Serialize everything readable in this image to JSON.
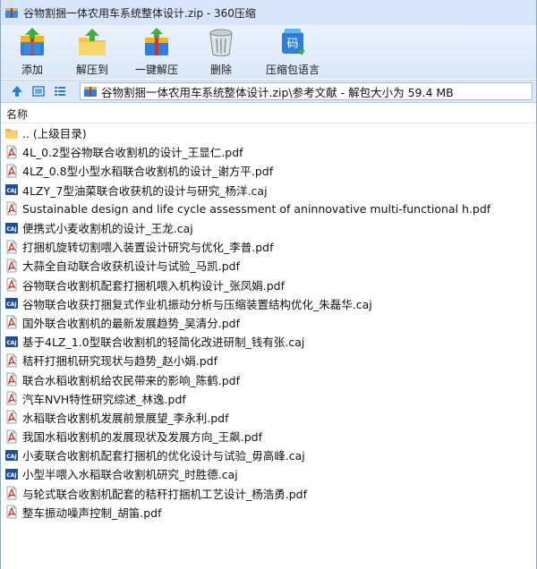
{
  "window": {
    "title": "谷物割捆一体农用车系统整体设计.zip - 360压缩"
  },
  "toolbar": {
    "buttons": [
      {
        "label": "添加",
        "icon": "add-archive-icon"
      },
      {
        "label": "解压到",
        "icon": "extract-to-icon"
      },
      {
        "label": "一键解压",
        "icon": "one-click-extract-icon"
      },
      {
        "label": "删除",
        "icon": "delete-trash-icon"
      },
      {
        "label": "压缩包语言",
        "icon": "archive-language-icon"
      }
    ],
    "language_glyph": "码"
  },
  "address": {
    "path": "谷物割捆一体农用车系统整体设计.zip\\参考文献 - 解包大小为 59.4 MB"
  },
  "columns": {
    "name": "名称"
  },
  "files": [
    {
      "name": ".. (上级目录)",
      "type": "folder"
    },
    {
      "name": "4L_0.2型谷物联合收割机的设计_王显仁.pdf",
      "type": "pdf"
    },
    {
      "name": "4LZ_0.8型小型水稻联合收割机的设计_谢方平.pdf",
      "type": "pdf"
    },
    {
      "name": "4LZY_7型油菜联合收获机的设计与研究_杨洋.caj",
      "type": "caj"
    },
    {
      "name": "Sustainable design and life cycle assessment of aninnovative multi-functional h.pdf",
      "type": "pdf"
    },
    {
      "name": "便携式小麦收割机的设计_王龙.caj",
      "type": "caj"
    },
    {
      "name": "打捆机旋转切割喂入装置设计研究与优化_李普.pdf",
      "type": "pdf"
    },
    {
      "name": "大蒜全自动联合收获机设计与试验_马凯.pdf",
      "type": "pdf"
    },
    {
      "name": "谷物联合收割机配套打捆机喂入机构设计_张凤娟.pdf",
      "type": "pdf"
    },
    {
      "name": "谷物联合收获打捆复式作业机振动分析与压缩装置结构优化_朱磊华.caj",
      "type": "caj"
    },
    {
      "name": "国外联合收割机的最新发展趋势_吴清分.pdf",
      "type": "pdf"
    },
    {
      "name": "基于4LZ_1.0型联合收割机的轻简化改进研制_钱有张.caj",
      "type": "caj"
    },
    {
      "name": "秸秆打捆机研究现状与趋势_赵小娟.pdf",
      "type": "pdf"
    },
    {
      "name": "联合水稻收割机给农民带来的影响_陈鹤.pdf",
      "type": "pdf"
    },
    {
      "name": "汽车NVH特性研究综述_林逸.pdf",
      "type": "pdf"
    },
    {
      "name": "水稻联合收割机发展前景展望_李永利.pdf",
      "type": "pdf"
    },
    {
      "name": "我国水稻收割机的发展现状及发展方向_王飙.pdf",
      "type": "pdf"
    },
    {
      "name": "小麦联合收割机配套打捆机的优化设计与试验_毋高峰.caj",
      "type": "caj"
    },
    {
      "name": "小型半喂入水稻联合收割机研究_时胜德.caj",
      "type": "caj"
    },
    {
      "name": "与轮式联合收割机配套的秸秆打捆机工艺设计_杨浩勇.pdf",
      "type": "pdf"
    },
    {
      "name": "整车振动噪声控制_胡笛.pdf",
      "type": "pdf"
    }
  ]
}
